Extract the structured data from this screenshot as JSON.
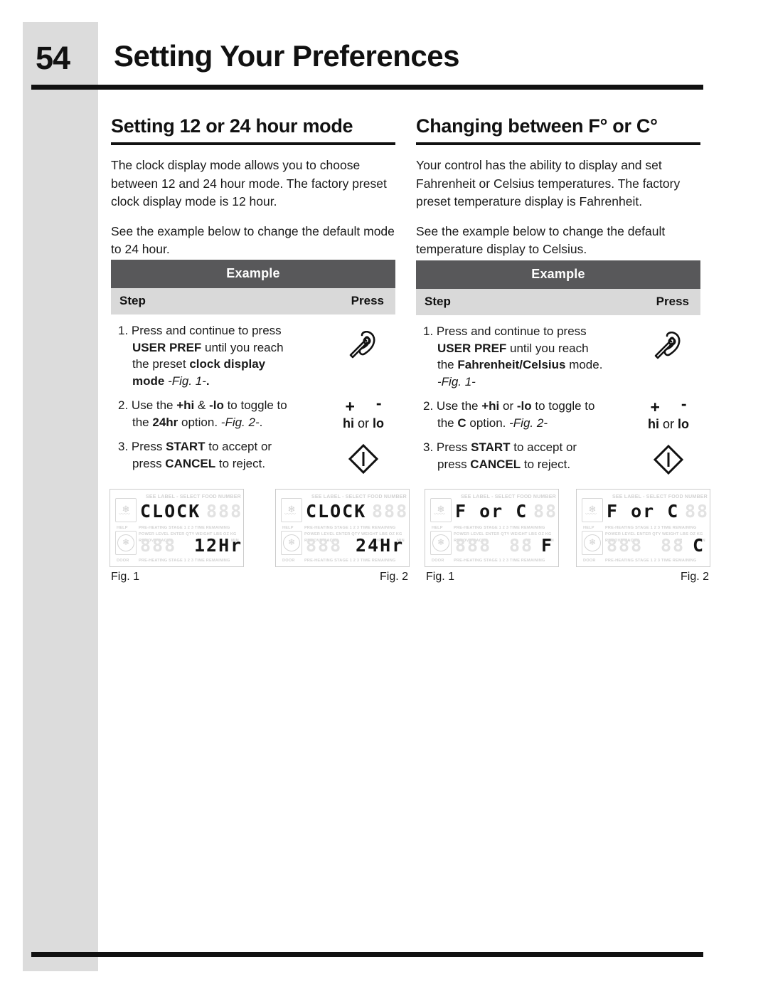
{
  "header": {
    "page_number": "54",
    "title": "Setting Your Preferences"
  },
  "columns": [
    {
      "heading": "Setting 12 or 24 hour mode",
      "paragraphs": [
        "The clock display mode allows you to choose between 12 and 24 hour mode. The factory preset clock display mode is 12 hour.",
        "See the example below to change the default mode to 24 hour."
      ],
      "table": {
        "title": "Example",
        "col_step": "Step",
        "col_press": "Press",
        "rows": [
          {
            "num": "1.",
            "line1_a": "Press and continue to press",
            "line2_bold": "USER PREF",
            "line2_rest": " until you reach",
            "line3_a": "the preset ",
            "line3_bold": "clock display",
            "line4_bold": "mode",
            "line4_italic": " -Fig. 1-",
            "line4_end": ".",
            "press_icon": "user-pref-wrench-icon"
          },
          {
            "num": "2.",
            "line1_a": "Use the ",
            "line1_bold1": "+hi",
            "line1_mid": " & ",
            "line1_bold2": "-lo",
            "line1_end": " to toggle to",
            "line2_a": "the ",
            "line2_bold": "24hr",
            "line2_mid": " option. ",
            "line2_italic": "-Fig. 2-",
            "line2_end": ".",
            "press_plus": "+",
            "press_minus": "-",
            "press_hi": "hi",
            "press_or": " or ",
            "press_lo": "lo"
          },
          {
            "num": "3.",
            "line1_a": "Press ",
            "line1_bold": "START",
            "line1_end": "  to accept or",
            "line2_a": "press ",
            "line2_bold": "CANCEL",
            "line2_end": " to reject.",
            "press_icon": "start-diamond-icon"
          }
        ]
      },
      "figures": [
        {
          "caption": "Fig. 1",
          "caption_side": "left",
          "top_display_on": "CLOCK",
          "top_display_off": "888",
          "bottom_left_off": "888",
          "bottom_display_on": "12Hr"
        },
        {
          "caption": "Fig. 2",
          "caption_side": "right",
          "top_display_on": "CLOCK",
          "top_display_off": "888",
          "bottom_left_off": "888",
          "bottom_display_on": "24Hr"
        }
      ]
    },
    {
      "heading": "Changing between F° or C°",
      "paragraphs": [
        "Your control has the ability to display and set Fahrenheit or Celsius temperatures. The factory preset temperature display is Fahrenheit.",
        "See the example below to change the default temperature display to Celsius."
      ],
      "table": {
        "title": "Example",
        "col_step": "Step",
        "col_press": "Press",
        "rows": [
          {
            "num": "1.",
            "line1_a": "Press and continue to press",
            "line2_bold": "USER PREF",
            "line2_rest": " until you reach",
            "line3_a": "the ",
            "line3_bold": "Fahrenheit/Celsius",
            "line3_end": " mode.",
            "line4_italic": "-Fig. 1-",
            "press_icon": "user-pref-wrench-icon"
          },
          {
            "num": "2.",
            "line1_a": "Use the ",
            "line1_bold1": "+hi",
            "line1_mid": " or ",
            "line1_bold2": "-lo",
            "line1_end": " to toggle to",
            "line2_a": "the ",
            "line2_bold": "C",
            "line2_mid": " option. ",
            "line2_italic": "-Fig. 2-",
            "press_plus": "+",
            "press_minus": "-",
            "press_hi": "hi",
            "press_or": " or ",
            "press_lo": "lo"
          },
          {
            "num": "3.",
            "line1_a": "Press ",
            "line1_bold": "START",
            "line1_end": " to accept or",
            "line2_a": "press ",
            "line2_bold": "CANCEL",
            "line2_end": " to reject.",
            "press_icon": "start-diamond-icon"
          }
        ]
      },
      "figures": [
        {
          "caption": "Fig. 1",
          "caption_side": "left",
          "top_display_on": "F or C",
          "top_display_off": "888",
          "bottom_left_off": "888",
          "bottom_display_on": "F"
        },
        {
          "caption": "Fig. 2",
          "caption_side": "right",
          "top_display_on": "F or C",
          "top_display_off": "888",
          "bottom_left_off": "888",
          "bottom_display_on": "C"
        }
      ]
    }
  ],
  "lcd_labels": {
    "top_banner": "SEE LABEL - SELECT FOOD NUMBER",
    "row1": "PRE-HEATING      STAGE 1 2 3      TIME REMAINING",
    "row2": "POWER LEVEL   ENTER QTY WEIGHT      LBS OZ KG",
    "help": "HELP",
    "door": "DOOR",
    "remove_racks": "REMOVE RACKS",
    "bottom": "PRE-HEATING     STAGE 1 2 3     TIME REMAINING",
    "hr": "HR",
    "min": "MIN"
  },
  "colors": {
    "spine_gray": "#dcdcdc",
    "table_title_bg": "#58585a",
    "table_subhead_bg": "#d9d9d9",
    "rule_black": "#111111",
    "lcd_off_segment": "#e2e2e2"
  }
}
